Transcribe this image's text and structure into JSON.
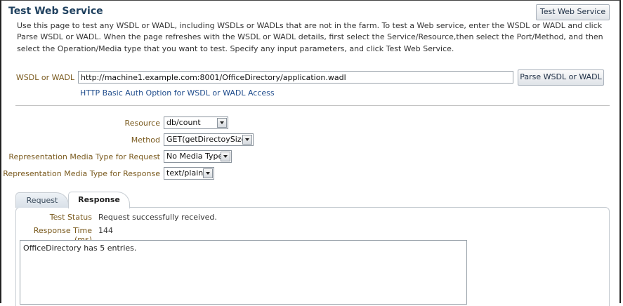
{
  "page": {
    "title": "Test Web Service",
    "test_button_label": "Test Web Service",
    "description": "Use this page to test any WSDL or WADL, including WSDLs or WADLs that are not in the farm. To test a Web service, enter the WSDL or WADL and click Parse WSDL or WADL. When the page refreshes with the WSDL or WADL details, first select the Service/Resource,then select the Port/Method, and then select the Operation/Media type that you want to test. Specify any input parameters, and click Test Web Service."
  },
  "wsdl": {
    "label": "WSDL or WADL",
    "value": "http://machine1.example.com:8001/OfficeDirectory/application.wadl",
    "parse_button_label": "Parse WSDL or WADL",
    "auth_link": "HTTP Basic Auth Option for WSDL or WADL Access"
  },
  "form": {
    "resource": {
      "label": "Resource",
      "value": "db/count"
    },
    "method": {
      "label": "Method",
      "value": "GET(getDirectoySize)"
    },
    "request_media": {
      "label": "Representation Media Type for Request",
      "value": "No Media Type"
    },
    "response_media": {
      "label": "Representation Media Type for Response",
      "value": "text/plain"
    }
  },
  "tabs": {
    "request": "Request",
    "response": "Response"
  },
  "response": {
    "status_label": "Test Status",
    "status_value": "Request successfully received.",
    "time_label": "Response Time (ms)",
    "time_value": "144",
    "body": "OfficeDirectory has 5 entries."
  }
}
